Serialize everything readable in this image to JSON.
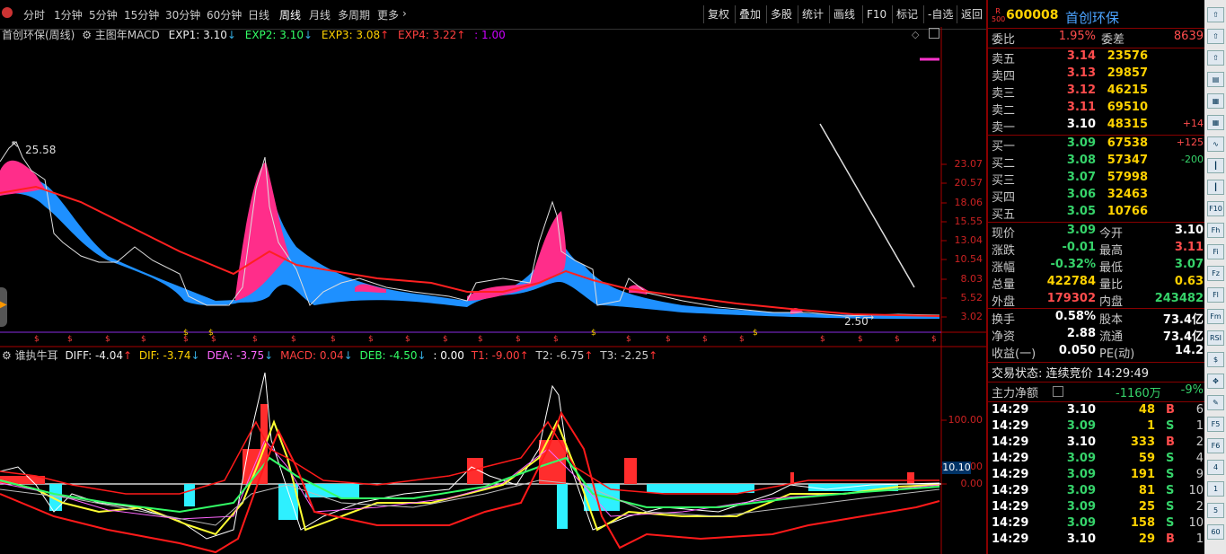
{
  "topbar": {
    "periods": [
      "分时",
      "1分钟",
      "5分钟",
      "15分钟",
      "30分钟",
      "60分钟",
      "日线",
      "周线",
      "月线",
      "多周期",
      "更多"
    ],
    "active_period": "周线",
    "tools": [
      "复权",
      "叠加",
      "多股",
      "统计",
      "画线",
      "F10",
      "标记",
      "-自选",
      "返回"
    ]
  },
  "main_legend": {
    "title": "首创环保(周线)",
    "indicator": "主图年MACD",
    "exp1": "EXP1: 3.10",
    "exp2": "EXP2: 3.10",
    "exp3": "EXP3: 3.08",
    "exp4": "EXP4: 3.22",
    "extra": ": 1.00"
  },
  "price_axis": [
    "23.07",
    "20.57",
    "18.06",
    "15.55",
    "13.04",
    "10.54",
    "8.03",
    "5.52",
    "3.02"
  ],
  "price_marks": {
    "high": "25.58",
    "low": "2.50"
  },
  "sub_legend": {
    "name": "谁执牛耳",
    "diff1": "DIFF: -4.04",
    "dif": "DIF: -3.74",
    "dea": "DEA: -3.75",
    "macd": "MACD: 0.04",
    "deb": "DEB: -4.50",
    "zero": ": 0.00",
    "t1": "T1: -9.00",
    "t2": "T2: -6.75",
    "t3": "T3: -2.25"
  },
  "sub_axis": [
    "100.00",
    "50.00",
    "0.00"
  ],
  "sub_marker": "10.10",
  "stock": {
    "code": "600008",
    "name": "首创环保",
    "badge_top": "R",
    "badge_bottom": "500"
  },
  "weibi": {
    "label": "委比",
    "value": "1.95%",
    "label2": "委差",
    "value2": "8639"
  },
  "sell": [
    {
      "label": "卖五",
      "price": "3.14",
      "vol": "23576",
      "chg": ""
    },
    {
      "label": "卖四",
      "price": "3.13",
      "vol": "29857",
      "chg": ""
    },
    {
      "label": "卖三",
      "price": "3.12",
      "vol": "46215",
      "chg": ""
    },
    {
      "label": "卖二",
      "price": "3.11",
      "vol": "69510",
      "chg": ""
    },
    {
      "label": "卖一",
      "price": "3.10",
      "vol": "48315",
      "chg": "+14"
    }
  ],
  "buy": [
    {
      "label": "买一",
      "price": "3.09",
      "vol": "67538",
      "chg": "+125"
    },
    {
      "label": "买二",
      "price": "3.08",
      "vol": "57347",
      "chg": "-200"
    },
    {
      "label": "买三",
      "price": "3.07",
      "vol": "57998",
      "chg": ""
    },
    {
      "label": "买四",
      "price": "3.06",
      "vol": "32463",
      "chg": ""
    },
    {
      "label": "买五",
      "price": "3.05",
      "vol": "10766",
      "chg": ""
    }
  ],
  "quote": [
    {
      "l1": "现价",
      "v1": "3.09",
      "l2": "今开",
      "v2": "3.10"
    },
    {
      "l1": "涨跌",
      "v1": "-0.01",
      "l2": "最高",
      "v2": "3.11"
    },
    {
      "l1": "涨幅",
      "v1": "-0.32%",
      "l2": "最低",
      "v2": "3.07"
    },
    {
      "l1": "总量",
      "v1": "422784",
      "l2": "量比",
      "v2": "0.63"
    },
    {
      "l1": "外盘",
      "v1": "179302",
      "l2": "内盘",
      "v2": "243482"
    }
  ],
  "fund": [
    {
      "l1": "换手",
      "v1": "0.58%",
      "l2": "股本",
      "v2": "73.4亿"
    },
    {
      "l1": "净资",
      "v1": "2.88",
      "l2": "流通",
      "v2": "73.4亿"
    },
    {
      "l1": "收益(一)",
      "v1": "0.050",
      "l2": "PE(动)",
      "v2": "14.2"
    }
  ],
  "trade_status": "交易状态: 连续竞价 14:29:49",
  "main_flow": {
    "label": "主力净额",
    "value": "-1160万",
    "pct": "-9%"
  },
  "ticks": [
    {
      "t": "14:29",
      "p": "3.10",
      "v": "48",
      "bs": "B",
      "n": "6"
    },
    {
      "t": "14:29",
      "p": "3.09",
      "v": "1",
      "bs": "S",
      "n": "1"
    },
    {
      "t": "14:29",
      "p": "3.10",
      "v": "333",
      "bs": "B",
      "n": "2"
    },
    {
      "t": "14:29",
      "p": "3.09",
      "v": "59",
      "bs": "S",
      "n": "4"
    },
    {
      "t": "14:29",
      "p": "3.09",
      "v": "191",
      "bs": "S",
      "n": "9"
    },
    {
      "t": "14:29",
      "p": "3.09",
      "v": "81",
      "bs": "S",
      "n": "10"
    },
    {
      "t": "14:29",
      "p": "3.09",
      "v": "25",
      "bs": "S",
      "n": "2"
    },
    {
      "t": "14:29",
      "p": "3.09",
      "v": "158",
      "bs": "S",
      "n": "10"
    },
    {
      "t": "14:29",
      "p": "3.10",
      "v": "29",
      "bs": "B",
      "n": "1"
    }
  ],
  "side_icons": [
    "up-icon",
    "up-icon",
    "up-icon",
    "list-icon",
    "grid-icon",
    "grid-icon",
    "chart-icon",
    "candle-icon",
    "candle-icon",
    "f10-icon",
    "fh-icon",
    "f-icon",
    "fz-icon",
    "fl-icon",
    "fm-icon",
    "rsi-icon",
    "money-icon",
    "move-icon",
    "pen-icon",
    "f5-icon",
    "f6-icon",
    "4",
    "1",
    "5",
    "60"
  ]
}
